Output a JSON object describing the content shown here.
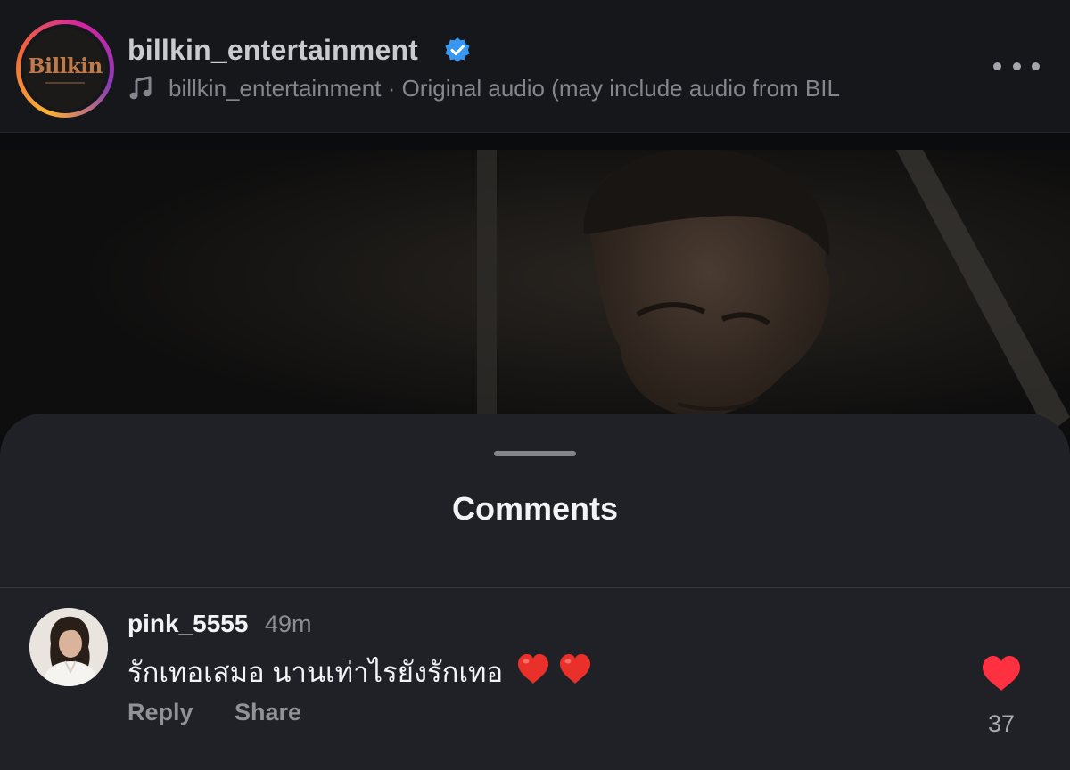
{
  "header": {
    "account_name": "billkin_entertainment",
    "logo_text": "Billkin",
    "audio_text": "billkin_entertainment · Original audio  (may include audio from BIL",
    "verified_color": "#3897f0"
  },
  "icons": {
    "verified": "verified-badge-icon",
    "music": "music-note-icon",
    "more": "more-options-icon",
    "like": "heart-icon"
  },
  "comments_sheet": {
    "title": "Comments",
    "comments": [
      {
        "username": "pink_5555",
        "time": "49m",
        "text": "รักเทอเสมอ นานเท่าไรยังรักเทอ",
        "emoji": [
          "heart",
          "heart"
        ],
        "reply_label": "Reply",
        "share_label": "Share",
        "like_count": "37",
        "liked": true,
        "like_color": "#ff3040"
      }
    ]
  }
}
